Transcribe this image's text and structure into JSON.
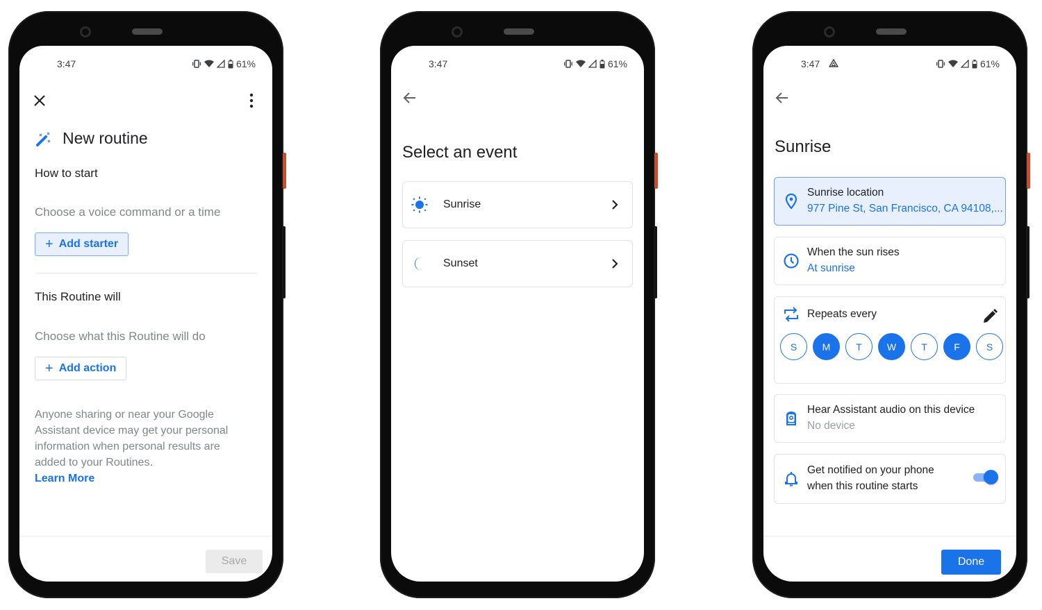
{
  "colors": {
    "accent": "#1a73e8",
    "accent_light": "#e8f0fe",
    "frame": "#0b0b0b",
    "side_button": "#c4502f"
  },
  "status_bar": {
    "time": "3:47",
    "battery": "61%",
    "icons": [
      "vibrate-icon",
      "wifi-icon",
      "signal-icon",
      "battery-icon"
    ]
  },
  "screen1": {
    "close_icon": "close-icon",
    "more_icon": "more-vert-icon",
    "title_icon": "magic-wand-icon",
    "title": "New routine",
    "how_to_start_label": "How to start",
    "starter_hint": "Choose a voice command or a time",
    "add_starter_label": "Add starter",
    "routine_will_label": "This Routine will",
    "action_hint": "Choose what this Routine will do",
    "add_action_label": "Add action",
    "disclaimer": "Anyone sharing or near your Google Assistant device may get your personal information when personal results are added to your Routines.",
    "learn_more": "Learn More",
    "save_label": "Save"
  },
  "screen2": {
    "back_icon": "arrow-back-icon",
    "title": "Select an event",
    "events": [
      {
        "label": "Sunrise",
        "icon": "sun-icon"
      },
      {
        "label": "Sunset",
        "icon": "moon-icon"
      }
    ]
  },
  "screen3": {
    "status_extra_icon": "drive-icon",
    "back_icon": "arrow-back-icon",
    "title": "Sunrise",
    "location": {
      "title": "Sunrise location",
      "value": "977 Pine St, San Francisco, CA 94108,..."
    },
    "timing": {
      "title": "When the sun rises",
      "value": "At sunrise"
    },
    "repeat": {
      "title": "Repeats every",
      "days": [
        {
          "label": "S",
          "selected": false
        },
        {
          "label": "M",
          "selected": true
        },
        {
          "label": "T",
          "selected": false
        },
        {
          "label": "W",
          "selected": true
        },
        {
          "label": "T",
          "selected": false
        },
        {
          "label": "F",
          "selected": true
        },
        {
          "label": "S",
          "selected": false
        }
      ]
    },
    "audio": {
      "title": "Hear Assistant audio on this device",
      "value": "No device"
    },
    "notify": {
      "line1": "Get notified on your phone",
      "line2": "when this routine starts",
      "enabled": true
    },
    "done_label": "Done"
  }
}
